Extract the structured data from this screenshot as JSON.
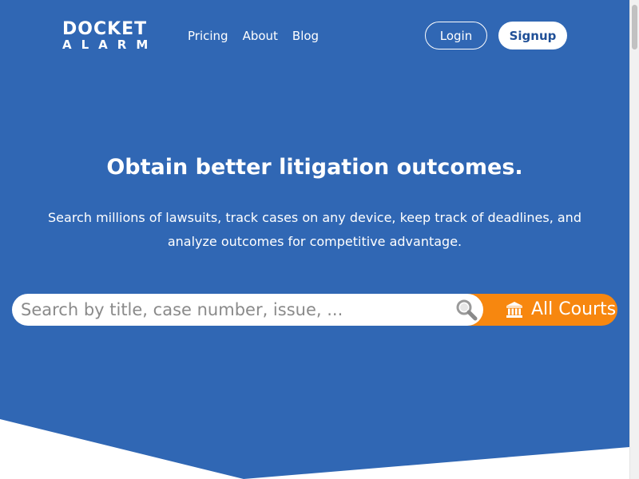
{
  "header": {
    "logo_top": "DOCKET",
    "logo_bottom": "ALARM",
    "nav": [
      {
        "label": "Pricing"
      },
      {
        "label": "About"
      },
      {
        "label": "Blog"
      }
    ],
    "login_label": "Login",
    "signup_label": "Signup"
  },
  "hero": {
    "headline": "Obtain better litigation outcomes.",
    "subtext": "Search millions of lawsuits, track cases on any device, keep track of deadlines, and analyze outcomes for competitive advantage."
  },
  "search": {
    "placeholder": "Search by title, case number, issue, ...",
    "value": "",
    "court_selector_label": "All Courts",
    "court_icon": "bank-icon",
    "search_icon": "search-icon"
  },
  "colors": {
    "hero_background": "#3067b4",
    "accent_orange": "#f7870f",
    "button_text_blue": "#1f4f97"
  }
}
